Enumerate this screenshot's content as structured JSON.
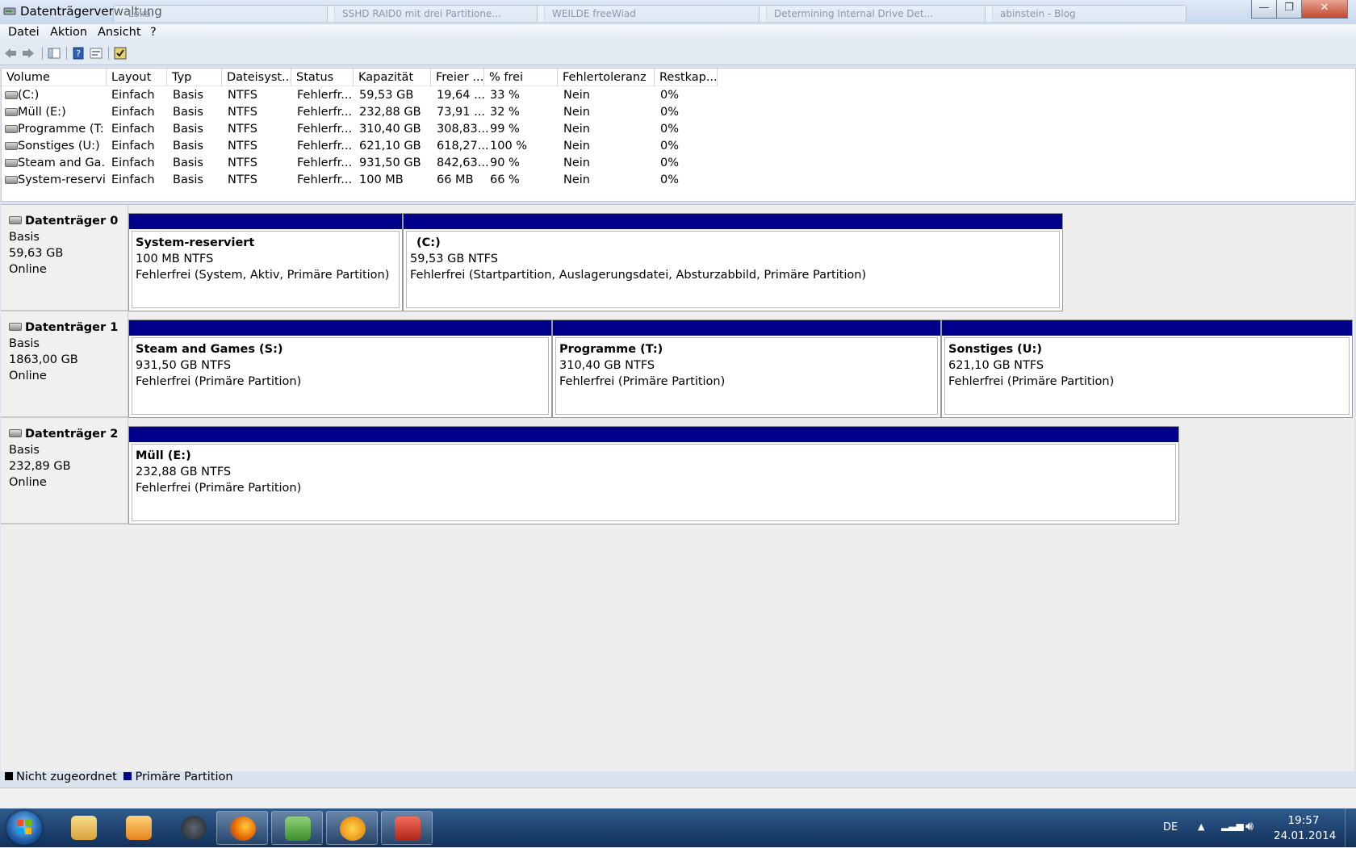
{
  "window": {
    "title": "Datenträgerverwaltung"
  },
  "background_tabs": [
    "Lokal",
    "SSHD RAID0 mit drei Partitione...",
    "WEILDE freeWiad",
    "Determining Internal Drive Det...",
    "abinstein - Blog"
  ],
  "menu": {
    "items": [
      "Datei",
      "Aktion",
      "Ansicht",
      "?"
    ]
  },
  "volume_list": {
    "columns": [
      "Volume",
      "Layout",
      "Typ",
      "Dateisyst...",
      "Status",
      "Kapazität",
      "Freier ...",
      "% frei",
      "Fehlertoleranz",
      "Restkap..."
    ],
    "rows": [
      {
        "volume": "(C:)",
        "layout": "Einfach",
        "typ": "Basis",
        "fs": "NTFS",
        "status": "Fehlerfr...",
        "kapazitaet": "59,53 GB",
        "frei": "19,64 ...",
        "prozent": "33 %",
        "fehlertoleranz": "Nein",
        "restkap": "0%"
      },
      {
        "volume": "Müll (E:)",
        "layout": "Einfach",
        "typ": "Basis",
        "fs": "NTFS",
        "status": "Fehlerfr...",
        "kapazitaet": "232,88 GB",
        "frei": "73,91 ...",
        "prozent": "32 %",
        "fehlertoleranz": "Nein",
        "restkap": "0%"
      },
      {
        "volume": "Programme (T:)",
        "layout": "Einfach",
        "typ": "Basis",
        "fs": "NTFS",
        "status": "Fehlerfr...",
        "kapazitaet": "310,40 GB",
        "frei": "308,83...",
        "prozent": "99 %",
        "fehlertoleranz": "Nein",
        "restkap": "0%"
      },
      {
        "volume": "Sonstiges (U:)",
        "layout": "Einfach",
        "typ": "Basis",
        "fs": "NTFS",
        "status": "Fehlerfr...",
        "kapazitaet": "621,10 GB",
        "frei": "618,27...",
        "prozent": "100 %",
        "fehlertoleranz": "Nein",
        "restkap": "0%"
      },
      {
        "volume": "Steam and Ga...",
        "layout": "Einfach",
        "typ": "Basis",
        "fs": "NTFS",
        "status": "Fehlerfr...",
        "kapazitaet": "931,50 GB",
        "frei": "842,63...",
        "prozent": "90 %",
        "fehlertoleranz": "Nein",
        "restkap": "0%"
      },
      {
        "volume": "System-reservi...",
        "layout": "Einfach",
        "typ": "Basis",
        "fs": "NTFS",
        "status": "Fehlerfr...",
        "kapazitaet": "100 MB",
        "frei": "66 MB",
        "prozent": "66 %",
        "fehlertoleranz": "Nein",
        "restkap": "0%"
      }
    ]
  },
  "disks": [
    {
      "name": "Datenträger 0",
      "type": "Basis",
      "size": "59,63 GB",
      "state": "Online",
      "partitions": [
        {
          "name": "System-reserviert",
          "size": "100 MB NTFS",
          "status": "Fehlerfrei (System, Aktiv, Primäre Partition)"
        },
        {
          "name": "(C:)",
          "size": "59,53 GB NTFS",
          "status": "Fehlerfrei (Startpartition, Auslagerungsdatei, Absturzabbild, Primäre Partition)"
        }
      ]
    },
    {
      "name": "Datenträger 1",
      "type": "Basis",
      "size": "1863,00 GB",
      "state": "Online",
      "partitions": [
        {
          "name": "Steam and Games  (S:)",
          "size": "931,50 GB NTFS",
          "status": "Fehlerfrei (Primäre Partition)"
        },
        {
          "name": "Programme  (T:)",
          "size": "310,40 GB NTFS",
          "status": "Fehlerfrei (Primäre Partition)"
        },
        {
          "name": "Sonstiges  (U:)",
          "size": "621,10 GB NTFS",
          "status": "Fehlerfrei (Primäre Partition)"
        }
      ]
    },
    {
      "name": "Datenträger 2",
      "type": "Basis",
      "size": "232,89 GB",
      "state": "Online",
      "partitions": [
        {
          "name": "Müll  (E:)",
          "size": "232,88 GB NTFS",
          "status": "Fehlerfrei (Primäre Partition)"
        }
      ]
    }
  ],
  "legend": {
    "unallocated": "Nicht zugeordnet",
    "unallocated_color": "#000000",
    "primary": "Primäre Partition",
    "primary_color": "#00008b"
  },
  "taskbar": {
    "apps": [
      "start-orb",
      "explorer-icon",
      "media-player-icon",
      "steam-icon",
      "firefox-icon",
      "disk-tool-icon",
      "info-tool-icon",
      "toolbox-icon"
    ],
    "language": "DE",
    "time": "19:57",
    "date": "24.01.2014"
  }
}
